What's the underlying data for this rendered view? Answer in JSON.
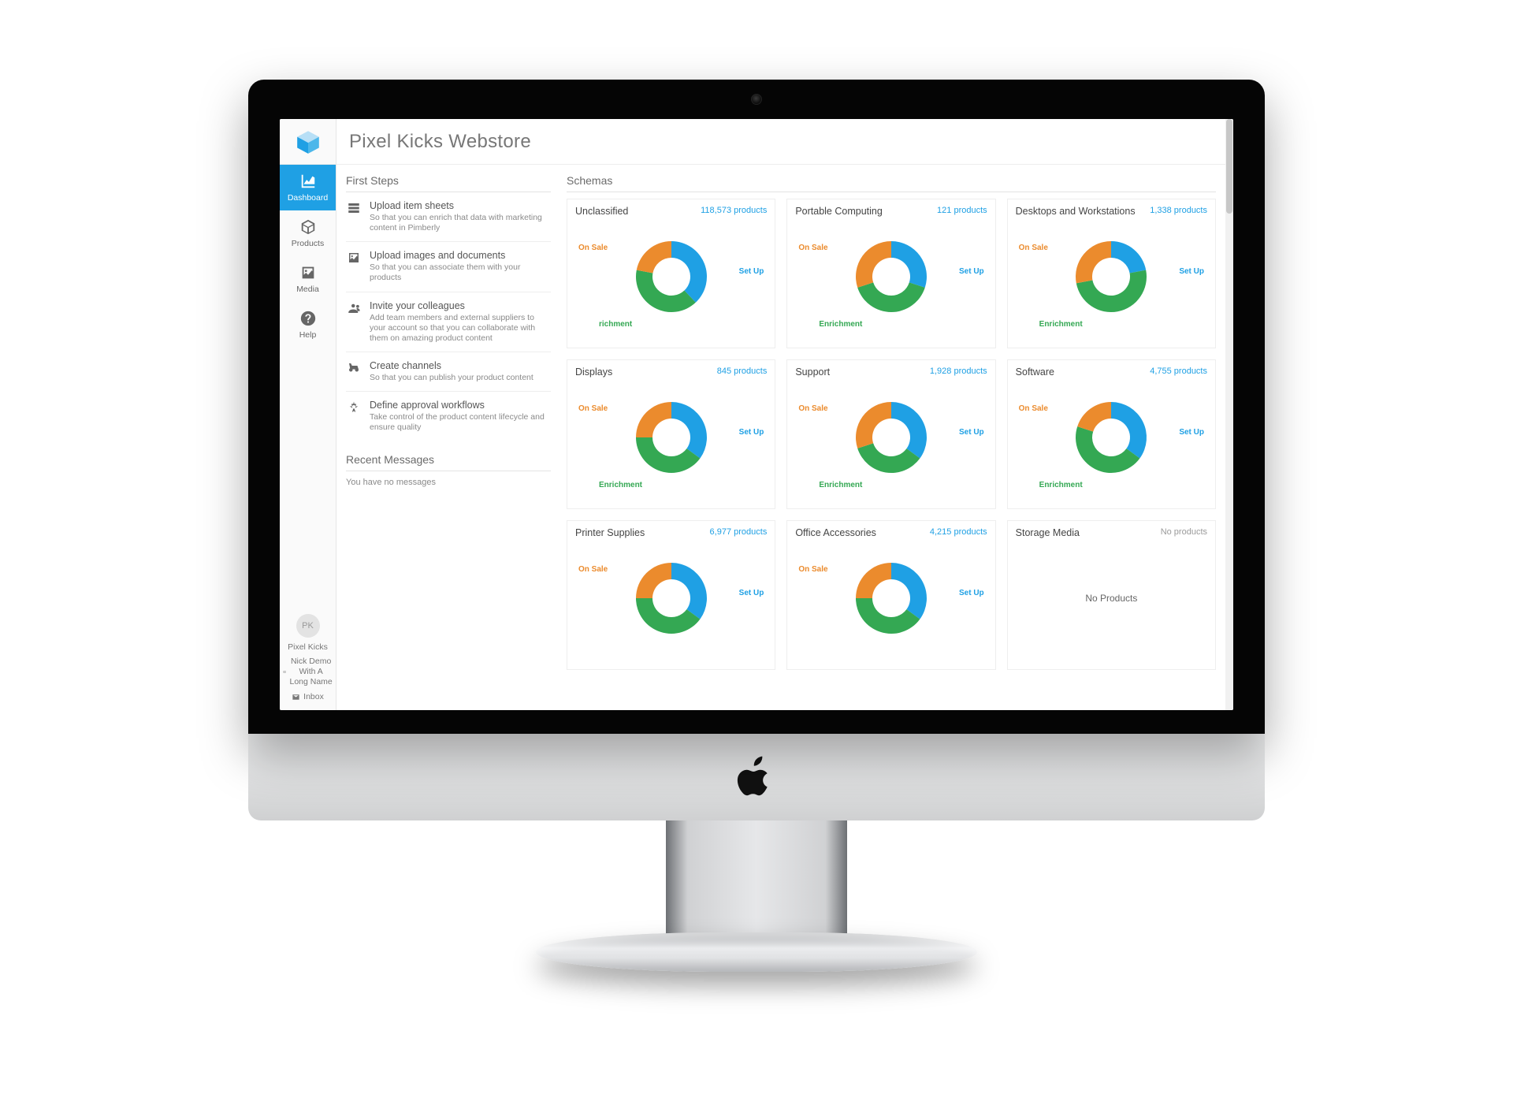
{
  "app": {
    "title": "Pixel Kicks Webstore"
  },
  "sidebar": {
    "items": [
      {
        "label": "Dashboard"
      },
      {
        "label": "Products"
      },
      {
        "label": "Media"
      },
      {
        "label": "Help"
      }
    ],
    "profile": {
      "avatar_initials": "PK",
      "name": "Pixel Kicks",
      "user": "Nick Demo With A Long Name",
      "inbox_label": "Inbox"
    }
  },
  "first_steps": {
    "heading": "First Steps",
    "items": [
      {
        "title": "Upload item sheets",
        "desc": "So that you can enrich that data with marketing content in Pimberly"
      },
      {
        "title": "Upload images and documents",
        "desc": "So that you can associate them with your products"
      },
      {
        "title": "Invite your colleagues",
        "desc": "Add team members and external suppliers to your account so that you can collaborate with them on amazing product content"
      },
      {
        "title": "Create channels",
        "desc": "So that you can publish your product content"
      },
      {
        "title": "Define approval workflows",
        "desc": "Take control of the product content lifecycle and ensure quality"
      }
    ]
  },
  "recent_messages": {
    "heading": "Recent Messages",
    "empty": "You have no messages"
  },
  "schemas": {
    "heading": "Schemas",
    "legend": {
      "setup": "Set Up",
      "enrichment": "Enrichment",
      "onsale": "On Sale"
    },
    "no_products_label": "No Products",
    "cards": [
      {
        "title": "Unclassified",
        "sub": "118,573 products",
        "has_chart": true,
        "labels": {
          "setup": "Set Up",
          "enrichment": "richment",
          "onsale": "On Sale"
        }
      },
      {
        "title": "Portable Computing",
        "sub": "121 products",
        "has_chart": true,
        "labels": {
          "setup": "Set Up",
          "enrichment": "Enrichment",
          "onsale": "On Sale"
        }
      },
      {
        "title": "Desktops and Workstations",
        "sub": "1,338 products",
        "has_chart": true,
        "labels": {
          "setup": "Set Up",
          "enrichment": "Enrichment",
          "onsale": "On Sale"
        }
      },
      {
        "title": "Displays",
        "sub": "845 products",
        "has_chart": true,
        "labels": {
          "setup": "Set Up",
          "enrichment": "Enrichment",
          "onsale": "On Sale"
        }
      },
      {
        "title": "Support",
        "sub": "1,928 products",
        "has_chart": true,
        "labels": {
          "setup": "Set Up",
          "enrichment": "Enrichment",
          "onsale": "On Sale"
        }
      },
      {
        "title": "Software",
        "sub": "4,755 products",
        "has_chart": true,
        "labels": {
          "setup": "Set Up",
          "enrichment": "Enrichment",
          "onsale": "On Sale"
        }
      },
      {
        "title": "Printer Supplies",
        "sub": "6,977 products",
        "has_chart": true,
        "labels": {
          "setup": "Set Up",
          "enrichment": "",
          "onsale": "On Sale"
        }
      },
      {
        "title": "Office Accessories",
        "sub": "4,215 products",
        "has_chart": true,
        "labels": {
          "setup": "Set Up",
          "enrichment": "",
          "onsale": "On Sale"
        }
      },
      {
        "title": "Storage Media",
        "sub": "No products",
        "has_chart": false
      }
    ]
  },
  "colors": {
    "setup": "#1fa0e4",
    "enrichment": "#34a853",
    "onsale": "#eb8b2d"
  },
  "chart_data": [
    {
      "title": "Unclassified",
      "type": "pie",
      "series": [
        {
          "name": "Set Up",
          "value": 38,
          "color": "#1fa0e4"
        },
        {
          "name": "Enrichment",
          "value": 40,
          "color": "#34a853"
        },
        {
          "name": "On Sale",
          "value": 22,
          "color": "#eb8b2d"
        }
      ],
      "note": "values are estimated percentage shares of the donut"
    },
    {
      "title": "Portable Computing",
      "type": "pie",
      "series": [
        {
          "name": "Set Up",
          "value": 30,
          "color": "#1fa0e4"
        },
        {
          "name": "Enrichment",
          "value": 40,
          "color": "#34a853"
        },
        {
          "name": "On Sale",
          "value": 30,
          "color": "#eb8b2d"
        }
      ]
    },
    {
      "title": "Desktops and Workstations",
      "type": "pie",
      "series": [
        {
          "name": "Set Up",
          "value": 22,
          "color": "#1fa0e4"
        },
        {
          "name": "Enrichment",
          "value": 50,
          "color": "#34a853"
        },
        {
          "name": "On Sale",
          "value": 28,
          "color": "#eb8b2d"
        }
      ]
    },
    {
      "title": "Displays",
      "type": "pie",
      "series": [
        {
          "name": "Set Up",
          "value": 35,
          "color": "#1fa0e4"
        },
        {
          "name": "Enrichment",
          "value": 40,
          "color": "#34a853"
        },
        {
          "name": "On Sale",
          "value": 25,
          "color": "#eb8b2d"
        }
      ]
    },
    {
      "title": "Support",
      "type": "pie",
      "series": [
        {
          "name": "Set Up",
          "value": 35,
          "color": "#1fa0e4"
        },
        {
          "name": "Enrichment",
          "value": 35,
          "color": "#34a853"
        },
        {
          "name": "On Sale",
          "value": 30,
          "color": "#eb8b2d"
        }
      ]
    },
    {
      "title": "Software",
      "type": "pie",
      "series": [
        {
          "name": "Set Up",
          "value": 35,
          "color": "#1fa0e4"
        },
        {
          "name": "Enrichment",
          "value": 45,
          "color": "#34a853"
        },
        {
          "name": "On Sale",
          "value": 20,
          "color": "#eb8b2d"
        }
      ]
    },
    {
      "title": "Printer Supplies",
      "type": "pie",
      "series": [
        {
          "name": "Set Up",
          "value": 35,
          "color": "#1fa0e4"
        },
        {
          "name": "Enrichment",
          "value": 40,
          "color": "#34a853"
        },
        {
          "name": "On Sale",
          "value": 25,
          "color": "#eb8b2d"
        }
      ]
    },
    {
      "title": "Office Accessories",
      "type": "pie",
      "series": [
        {
          "name": "Set Up",
          "value": 35,
          "color": "#1fa0e4"
        },
        {
          "name": "Enrichment",
          "value": 40,
          "color": "#34a853"
        },
        {
          "name": "On Sale",
          "value": 25,
          "color": "#eb8b2d"
        }
      ]
    },
    {
      "title": "Storage Media",
      "type": "pie",
      "series": [],
      "empty_label": "No Products"
    }
  ]
}
